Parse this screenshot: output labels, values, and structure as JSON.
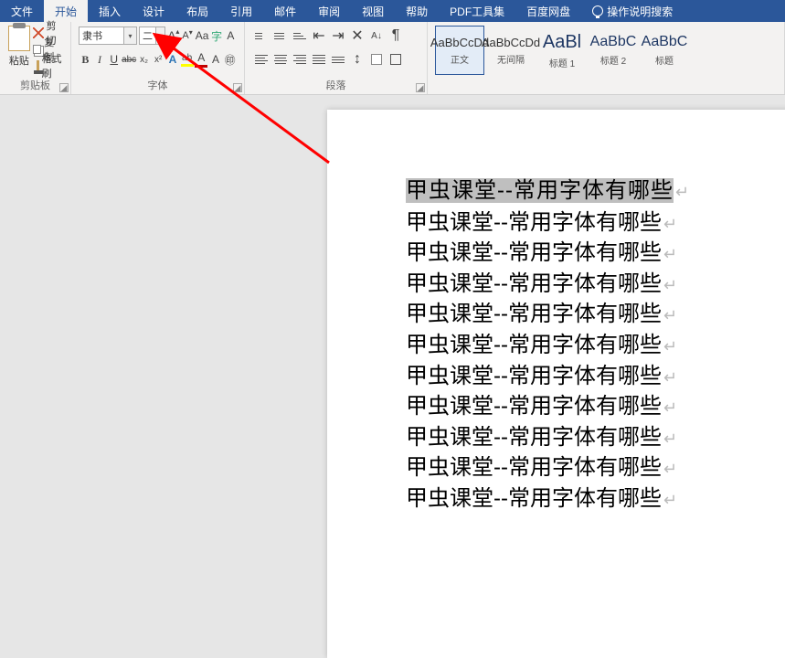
{
  "tabs": {
    "file": "文件",
    "home": "开始",
    "insert": "插入",
    "design": "设计",
    "layout": "布局",
    "references": "引用",
    "mailings": "邮件",
    "review": "审阅",
    "view": "视图",
    "help": "帮助",
    "pdf": "PDF工具集",
    "baidu": "百度网盘",
    "tell": "操作说明搜索"
  },
  "clipboard": {
    "paste": "粘贴",
    "cut": "剪切",
    "copy": "复制",
    "brush": "格式刷",
    "label": "剪贴板"
  },
  "font": {
    "name": "隶书",
    "size": "二",
    "label": "字体",
    "grow": "A",
    "shrink": "A",
    "caseBtn": "Aa",
    "clear": "A",
    "phonetic": "㊥",
    "border": "▢",
    "bold": "B",
    "italic": "I",
    "underline": "U",
    "strike": "abc",
    "sub": "x₂",
    "sup": "x²",
    "effects": "A",
    "highlight": "ab",
    "color": "A"
  },
  "para": {
    "label": "段落",
    "bullets": "•",
    "numbers": "1",
    "multi": "≡",
    "decInd": "⇤",
    "incInd": "⇥",
    "sort": "A↓",
    "marks": "¶",
    "left": "L",
    "center": "C",
    "right": "R",
    "just": "J",
    "dist": "D",
    "spacing": "↕",
    "shade": "▦",
    "borders": "▦"
  },
  "styles": {
    "items": [
      {
        "preview": "AaBbCcDd",
        "name": "正文",
        "sel": true,
        "cls": ""
      },
      {
        "preview": "AaBbCcDd",
        "name": "无间隔",
        "sel": false,
        "cls": ""
      },
      {
        "preview": "AaBl",
        "name": "标题 1",
        "sel": false,
        "cls": "big"
      },
      {
        "preview": "AaBbC",
        "name": "标题 2",
        "sel": false,
        "cls": "med"
      },
      {
        "preview": "AaBbC",
        "name": "标题",
        "sel": false,
        "cls": "med"
      }
    ]
  },
  "doc": {
    "lines": [
      {
        "text": "甲虫课堂--常用字体有哪些",
        "sel": true,
        "lishu": true
      },
      {
        "text": "甲虫课堂--常用字体有哪些",
        "sel": false,
        "lishu": false
      },
      {
        "text": "甲虫课堂--常用字体有哪些",
        "sel": false,
        "lishu": false
      },
      {
        "text": "甲虫课堂--常用字体有哪些",
        "sel": false,
        "lishu": false
      },
      {
        "text": "甲虫课堂--常用字体有哪些",
        "sel": false,
        "lishu": false
      },
      {
        "text": "甲虫课堂--常用字体有哪些",
        "sel": false,
        "lishu": false
      },
      {
        "text": "甲虫课堂--常用字体有哪些",
        "sel": false,
        "lishu": false
      },
      {
        "text": "甲虫课堂--常用字体有哪些",
        "sel": false,
        "lishu": false
      },
      {
        "text": "甲虫课堂--常用字体有哪些",
        "sel": false,
        "lishu": false
      },
      {
        "text": "甲虫课堂--常用字体有哪些",
        "sel": false,
        "lishu": false
      },
      {
        "text": "甲虫课堂--常用字体有哪些",
        "sel": false,
        "lishu": false
      }
    ]
  },
  "annotation": {
    "arrow_color": "#ff0000"
  }
}
